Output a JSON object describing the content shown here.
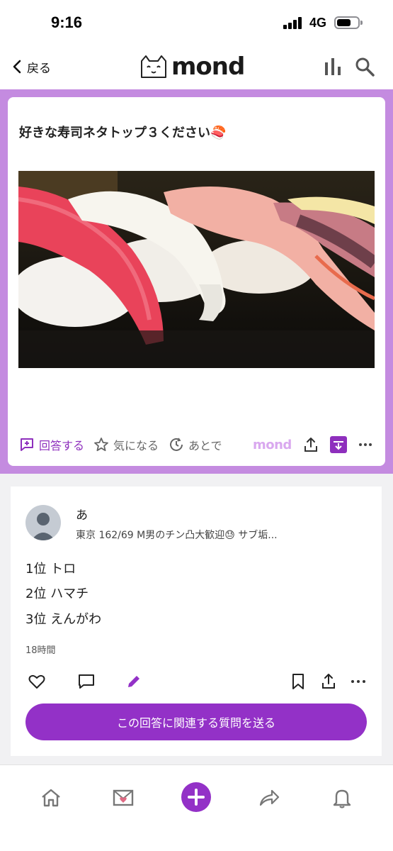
{
  "status_bar": {
    "time": "9:16",
    "network": "4G"
  },
  "header": {
    "back_label": "戻る",
    "logo_text": "mond",
    "icons": [
      "bar-chart-icon",
      "search-icon"
    ]
  },
  "question": {
    "title": "好きな寿司ネタトップ３ください🍣",
    "image": "sushi-photo",
    "actions": {
      "answer": "回答する",
      "interest": "気になる",
      "later": "あとで",
      "brand": "mond"
    }
  },
  "answer": {
    "name": "あ",
    "profile": "東京 162/69 M男のチン凸大歓迎😓 サブ垢...",
    "lines": [
      "1位 トロ",
      "2位 ハマチ",
      "3位 えんがわ"
    ],
    "time": "18時間",
    "send_button": "この回答に関連する質問を送る"
  },
  "bottom_nav": [
    "home-icon",
    "mail-icon",
    "plus-icon",
    "share-icon",
    "bell-icon"
  ],
  "colors": {
    "accent": "#9331c7",
    "frame": "#c48be0"
  }
}
